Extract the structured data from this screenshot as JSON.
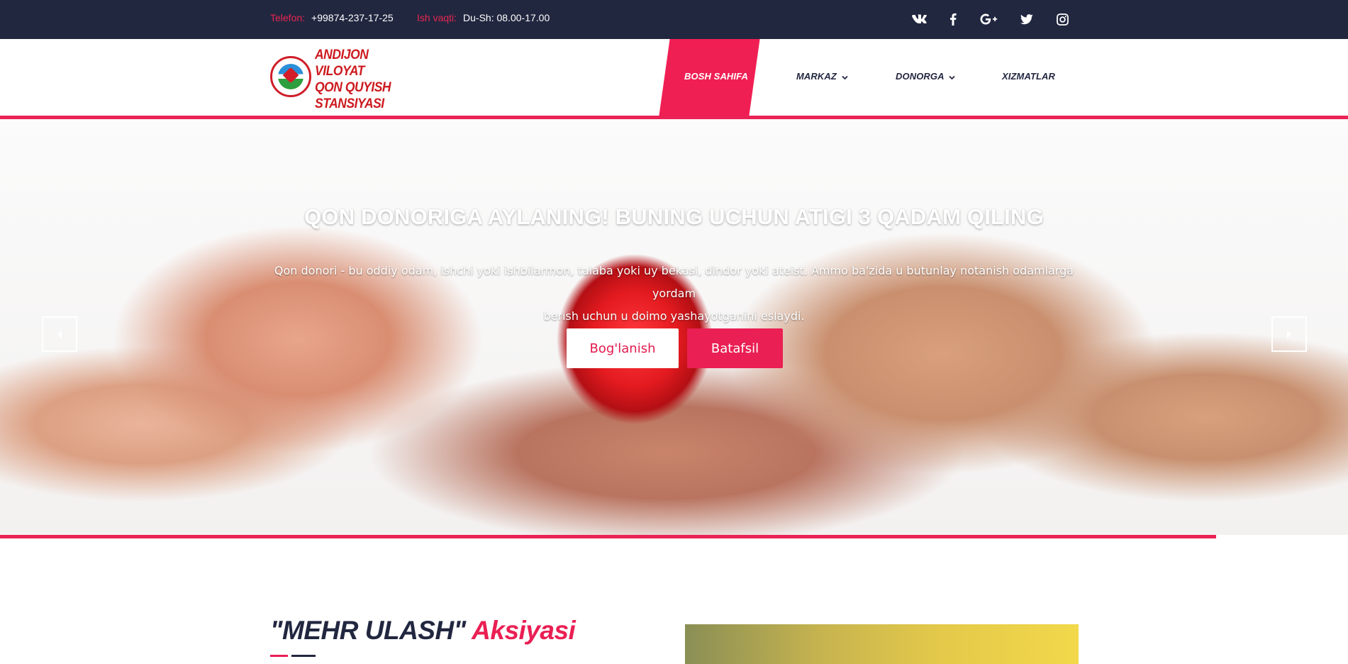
{
  "topbar": {
    "phone_label": "Telefon:",
    "phone_value": "+99874-237-17-25",
    "hours_label": "Ish vaqti:",
    "hours_value": "Du-Sh: 08.00-17.00",
    "social_icons": [
      "vk-icon",
      "facebook-icon",
      "google-plus-icon",
      "twitter-icon",
      "instagram-icon"
    ]
  },
  "logo": {
    "line1": "ANDIJON VILOYAT",
    "line2": "QON QUYISH",
    "line3": "STANSIYASI"
  },
  "nav": {
    "items": [
      {
        "label": "BOSH SAHIFA",
        "active": true
      },
      {
        "label": "MARKAZ",
        "dropdown": true
      },
      {
        "label": "DONORGA",
        "dropdown": true
      },
      {
        "label": "XIZMATLAR"
      }
    ],
    "chevron": "⌄"
  },
  "hero": {
    "title": "QON DONORIGA AYLANING! BUNING UCHUN ATIGI 3 QADAM QILING",
    "text_line1": "Qon donori - bu oddiy odam, ishchi yoki ishbilarmon, talaba yoki uy bekasi, dindor yoki ateist. Ammo ba'zida u butunlay notanish odamlarga yordam",
    "text_line2": "berish uchun u doimo yashayotganini eslaydi.",
    "button_contact": "Bog'lanish",
    "button_more": "Batafsil"
  },
  "section": {
    "title_main": "\"MEHR ULASH\"",
    "title_accent": "Aksiyasi"
  },
  "colors": {
    "topbar": "#222740",
    "accent": "#ea1f53",
    "logo_text": "#cc1a1f"
  }
}
